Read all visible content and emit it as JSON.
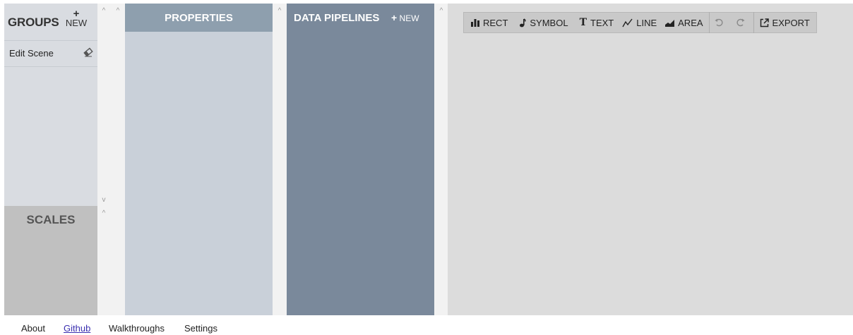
{
  "groups": {
    "title": "GROUPS",
    "new_plus": "+",
    "new_label": "NEW",
    "scene_item": "Edit Scene"
  },
  "scales": {
    "title": "SCALES"
  },
  "properties": {
    "title": "PROPERTIES"
  },
  "pipelines": {
    "title": "DATA PIPELINES",
    "new_plus": "+",
    "new_label": "NEW"
  },
  "toolbar": {
    "rect": "RECT",
    "symbol": "SYMBOL",
    "text": "TEXT",
    "line": "LINE",
    "area": "AREA",
    "export": "EXPORT",
    "text_glyph": "T"
  },
  "scroll": {
    "up": "^",
    "down": "v"
  },
  "footer": {
    "about": "About",
    "github": "Github",
    "walkthroughs": "Walkthroughs",
    "settings": "Settings"
  },
  "colors": {
    "groups_bg": "#d9dce1",
    "scales_bg": "#c0c0c0",
    "properties_bg": "#c9d0d9",
    "properties_header": "#8e9fae",
    "pipelines_bg": "#7a899b",
    "canvas_bg": "#dcdcdc",
    "toolbar_bg": "#c9c9c9",
    "link": "#3a2fb0"
  },
  "icons": [
    "bar-chart-icon",
    "music-note-icon",
    "text-icon",
    "line-chart-icon",
    "area-chart-icon",
    "undo-icon",
    "redo-icon",
    "export-icon",
    "eraser-icon"
  ]
}
